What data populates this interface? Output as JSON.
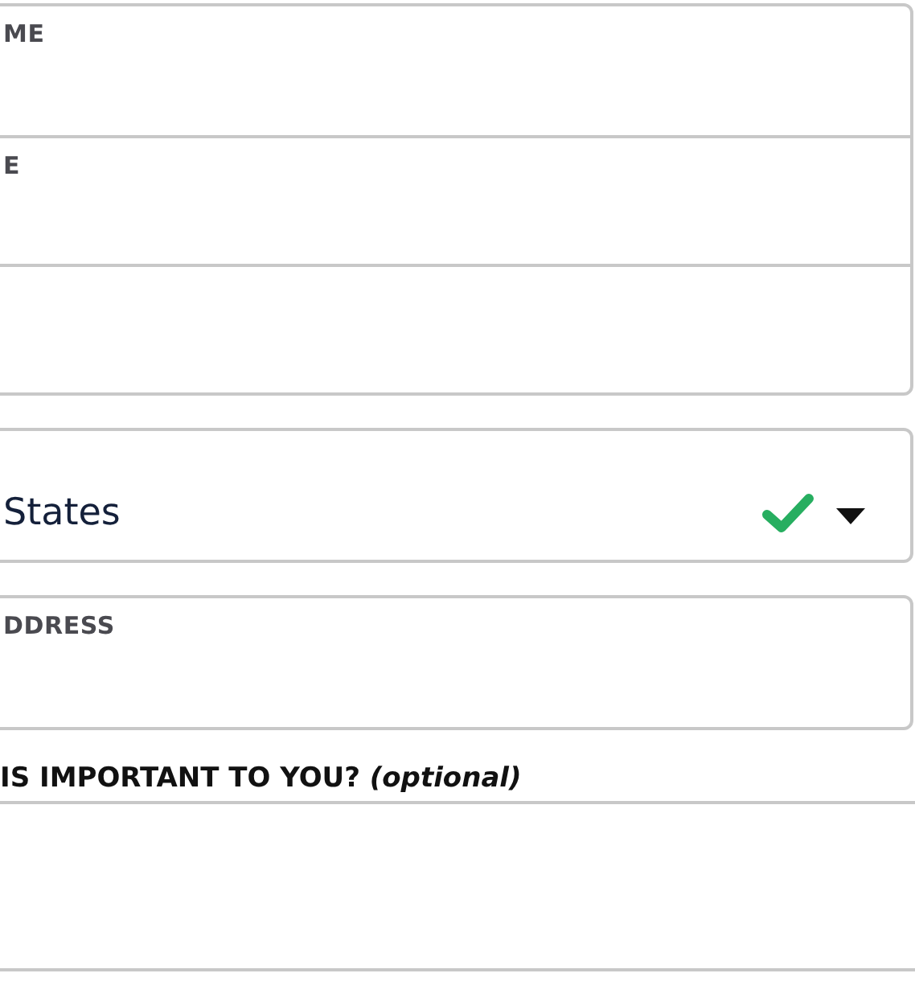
{
  "groups": [
    {
      "fields": [
        {
          "kind": "text",
          "label": "ME"
        },
        {
          "kind": "text",
          "label": "E"
        },
        {
          "kind": "text"
        }
      ]
    },
    {
      "fields": [
        {
          "kind": "select",
          "value": "States",
          "valid": true
        }
      ]
    },
    {
      "fields": [
        {
          "kind": "text",
          "label": "DDRESS"
        }
      ]
    }
  ],
  "question": {
    "label": "IS IMPORTANT TO YOU? *(optional)*"
  }
}
